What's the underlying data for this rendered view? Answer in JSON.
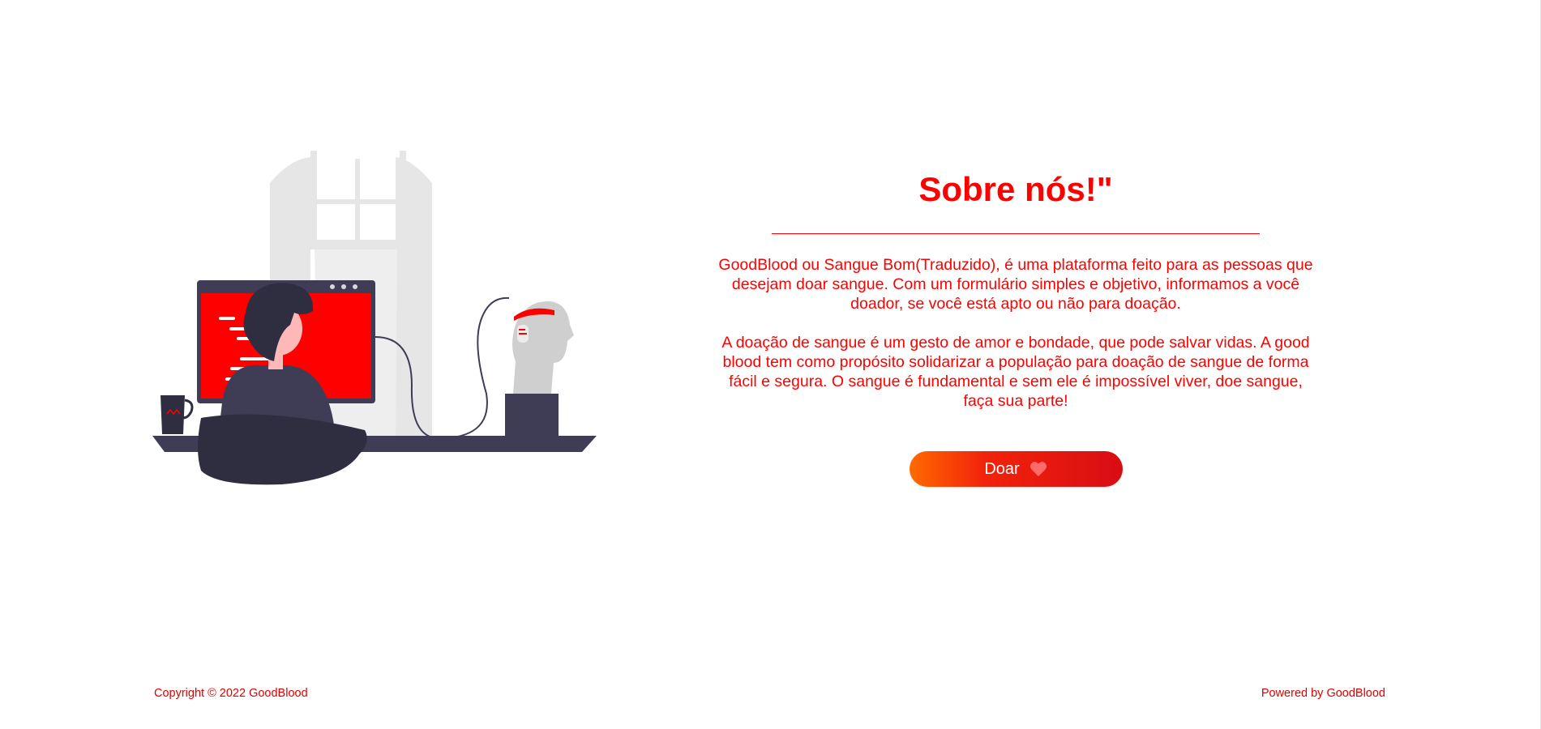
{
  "about": {
    "title": "Sobre nós!\"",
    "paragraph1": "GoodBlood ou Sangue Bom(Traduzido), é uma plataforma feito para as pessoas que desejam doar sangue. Com um formulário simples e objetivo, informamos a você doador, se você está apto ou não para doação.",
    "paragraph2": "A doação de sangue é um gesto de amor e bondade, que pode salvar vidas. A good blood tem como propósito solidarizar a população para doação de sangue de forma fácil e segura. O sangue é fundamental e sem ele é impossível viver, doe sangue, faça sua parte!",
    "button_label": "Doar",
    "button_icon": "heart-icon"
  },
  "footer": {
    "copyright": "Copyright © 2022 GoodBlood",
    "powered_by": "Powered by GoodBlood"
  },
  "colors": {
    "accent": "#ff0000",
    "button_gradient_start": "#ff6a00",
    "button_gradient_end": "#d80d13",
    "dark": "#3f3d56",
    "light_gray": "#e6e6e6"
  },
  "illustration": {
    "icon": "developer-at-computer-illustration"
  }
}
